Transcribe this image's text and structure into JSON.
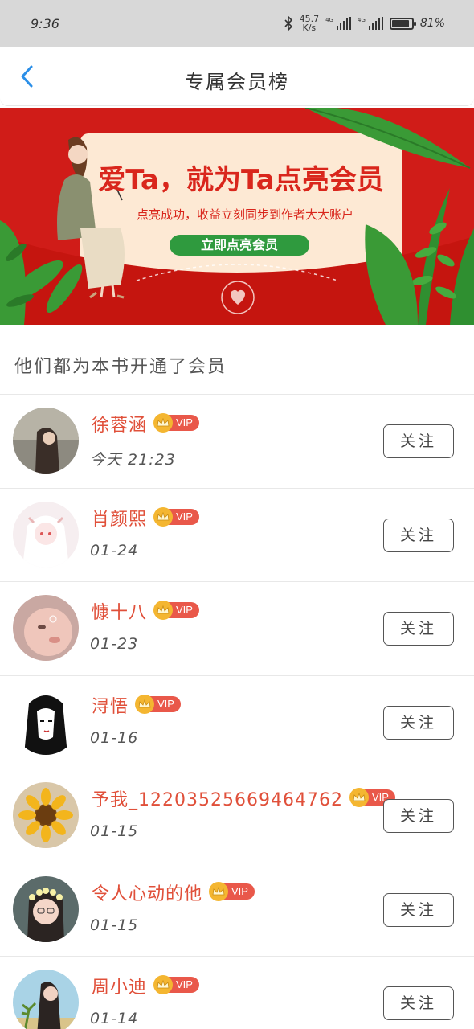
{
  "status_bar": {
    "time": "9:36",
    "net_speed_value": "45.7",
    "net_speed_unit": "K/s",
    "network_1": "4G",
    "network_2": "4G",
    "battery_percent": "81%",
    "battery_level": 0.81,
    "icons": [
      "bluetooth-icon",
      "signal-icon",
      "signal-icon",
      "battery-icon"
    ]
  },
  "nav": {
    "back_icon": "chevron-left-icon",
    "title": "专属会员榜"
  },
  "banner": {
    "headline": "爱Ta，就为Ta点亮会员",
    "subtitle": "点亮成功，收益立刻同步到作者大大账户",
    "button_label": "立即点亮会员",
    "colors": {
      "background": "#d01c18",
      "card": "#fde9d4",
      "button": "#2f9a3e",
      "leaf": "#3a9a36"
    }
  },
  "section": {
    "title": "他们都为本书开通了会员"
  },
  "members": [
    {
      "name": "徐蓉涵",
      "badge": "VIP",
      "date": "今天 21:23",
      "follow_label": "关注"
    },
    {
      "name": "肖颜熙",
      "badge": "VIP",
      "date": "01-24",
      "follow_label": "关注"
    },
    {
      "name": "慷十八",
      "badge": "VIP",
      "date": "01-23",
      "follow_label": "关注"
    },
    {
      "name": "浔悟",
      "badge": "VIP",
      "date": "01-16",
      "follow_label": "关注"
    },
    {
      "name": "予我_12203525669464762",
      "badge": "VIP",
      "date": "01-15",
      "follow_label": "关注"
    },
    {
      "name": "令人心动的他",
      "badge": "VIP",
      "date": "01-15",
      "follow_label": "关注"
    },
    {
      "name": "周小迪",
      "badge": "VIP",
      "date": "01-14",
      "follow_label": "关注"
    }
  ],
  "colors": {
    "name_accent": "#e0503a",
    "vip_badge": "#e9584a",
    "crown": "#f4b631",
    "back_icon": "#2b8fe8"
  }
}
